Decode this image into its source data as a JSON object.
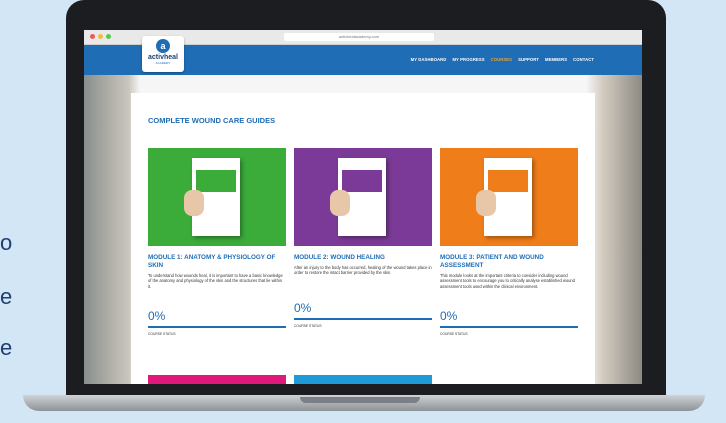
{
  "side_fragments": [
    "o",
    "e",
    "e"
  ],
  "browser": {
    "url": "activhealacademy.com"
  },
  "logo": {
    "mark": "a",
    "name": "activheal",
    "sub": "ACADEMY"
  },
  "nav": {
    "items": [
      "MY DASHBOARD",
      "MY PROGRESS",
      "COURSES",
      "SUPPORT",
      "MEMBERS",
      "CONTACT"
    ],
    "active_index": 2
  },
  "page": {
    "title": "COMPLETE WOUND CARE GUIDES"
  },
  "modules": [
    {
      "title": "MODULE 1: ANATOMY & PHYSIOLOGY OF SKIN",
      "description": "To understand how wounds heal, it is important to have a basic knowledge of the anatomy and physiology of the skin and the structures that lie within it.",
      "progress": "0%",
      "progress_value": 0,
      "status": "COURSE STATUS",
      "color": "#3bab3a"
    },
    {
      "title": "MODULE 2: WOUND HEALING",
      "description": "After an injury to the body has occurred, healing of the wound takes place in order to restore the intact barrier provided by the skin.",
      "progress": "0%",
      "progress_value": 0,
      "status": "COURSE STATUS",
      "color": "#7b3a97"
    },
    {
      "title": "MODULE 3: PATIENT AND WOUND ASSESSMENT",
      "description": "This module looks at the important criteria to consider including wound assessment tools to encourage you to critically analyse established wound assessment tools used within the clinical environment.",
      "progress": "0%",
      "progress_value": 0,
      "status": "COURSE STATUS",
      "color": "#ef7d1a"
    }
  ],
  "next_row_colors": [
    "#e0187a",
    "#1f9ad6"
  ],
  "colors": {
    "brand_blue": "#1f6db5",
    "title_blue": "#1f6db5",
    "active_nav": "#f0a230"
  }
}
